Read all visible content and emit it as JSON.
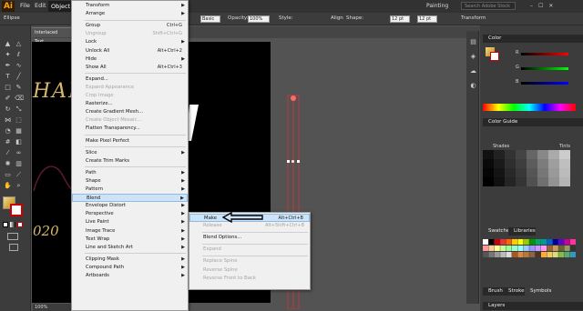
{
  "menubar": {
    "logo": "Ai",
    "items": [
      "File",
      "Edit",
      "Object"
    ],
    "workspace": "Painting",
    "search_placeholder": "Search Adobe Stock"
  },
  "control": {
    "selection": "Ellipse",
    "brush": "Basic",
    "opacity_label": "Opacity:",
    "opacity_value": "100%",
    "style_label": "Style:",
    "align_label": "Align",
    "shape_label": "Shape:",
    "w_value": "12 pt",
    "h_value": "12 pt",
    "transform_label": "Transform"
  },
  "document_tab": "Interlaced Text...",
  "artboard_text": [
    "HAPP",
    "020"
  ],
  "status": {
    "zoom": "100%"
  },
  "object_menu": {
    "items": [
      {
        "label": "Transform",
        "submenu": true
      },
      {
        "label": "Arrange",
        "submenu": true
      },
      {
        "sep": true
      },
      {
        "label": "Group",
        "shortcut": "Ctrl+G"
      },
      {
        "label": "Ungroup",
        "shortcut": "Shift+Ctrl+G",
        "disabled": true
      },
      {
        "label": "Lock",
        "submenu": true
      },
      {
        "label": "Unlock All",
        "shortcut": "Alt+Ctrl+2"
      },
      {
        "label": "Hide",
        "submenu": true
      },
      {
        "label": "Show All",
        "shortcut": "Alt+Ctrl+3"
      },
      {
        "sep": true
      },
      {
        "label": "Expand..."
      },
      {
        "label": "Expand Appearance",
        "disabled": true
      },
      {
        "label": "Crop Image",
        "disabled": true
      },
      {
        "label": "Rasterize..."
      },
      {
        "label": "Create Gradient Mesh..."
      },
      {
        "label": "Create Object Mosaic...",
        "disabled": true
      },
      {
        "label": "Flatten Transparency..."
      },
      {
        "sep": true
      },
      {
        "label": "Make Pixel Perfect"
      },
      {
        "sep": true
      },
      {
        "label": "Slice",
        "submenu": true
      },
      {
        "label": "Create Trim Marks"
      },
      {
        "sep": true
      },
      {
        "label": "Path",
        "submenu": true
      },
      {
        "label": "Shape",
        "submenu": true
      },
      {
        "label": "Pattern",
        "submenu": true
      },
      {
        "label": "Blend",
        "submenu": true,
        "highlight": true
      },
      {
        "label": "Envelope Distort",
        "submenu": true
      },
      {
        "label": "Perspective",
        "submenu": true
      },
      {
        "label": "Live Paint",
        "submenu": true
      },
      {
        "label": "Image Trace",
        "submenu": true
      },
      {
        "label": "Text Wrap",
        "submenu": true
      },
      {
        "label": "Line and Sketch Art",
        "submenu": true
      },
      {
        "sep": true
      },
      {
        "label": "Clipping Mask",
        "submenu": true
      },
      {
        "label": "Compound Path",
        "submenu": true
      },
      {
        "label": "Artboards",
        "submenu": true
      }
    ]
  },
  "blend_menu": {
    "items": [
      {
        "label": "Make",
        "shortcut": "Alt+Ctrl+B",
        "highlight": true
      },
      {
        "label": "Release",
        "shortcut": "Alt+Shift+Ctrl+B",
        "disabled": true
      },
      {
        "sep": true
      },
      {
        "label": "Blend Options..."
      },
      {
        "sep": true
      },
      {
        "label": "Expand",
        "disabled": true
      },
      {
        "sep": true
      },
      {
        "label": "Replace Spine",
        "disabled": true
      },
      {
        "label": "Reverse Spine",
        "disabled": true
      },
      {
        "label": "Reverse Front to Back",
        "disabled": true
      }
    ]
  },
  "panels": {
    "color": "Color",
    "color_guide": "Color Guide",
    "shades": "Shades",
    "tints": "Tints",
    "swatches": "Swatches",
    "libraries": "Libraries",
    "brushes": "Brushes",
    "stroke": "Stroke",
    "symbols": "Symbols",
    "layers": "Layers",
    "color_channels": [
      "R",
      "G",
      "B"
    ]
  },
  "colors": {
    "accent_orange": "#f7a21b",
    "menu_bg": "#f0f0f0",
    "highlight": "#cde3f8"
  }
}
